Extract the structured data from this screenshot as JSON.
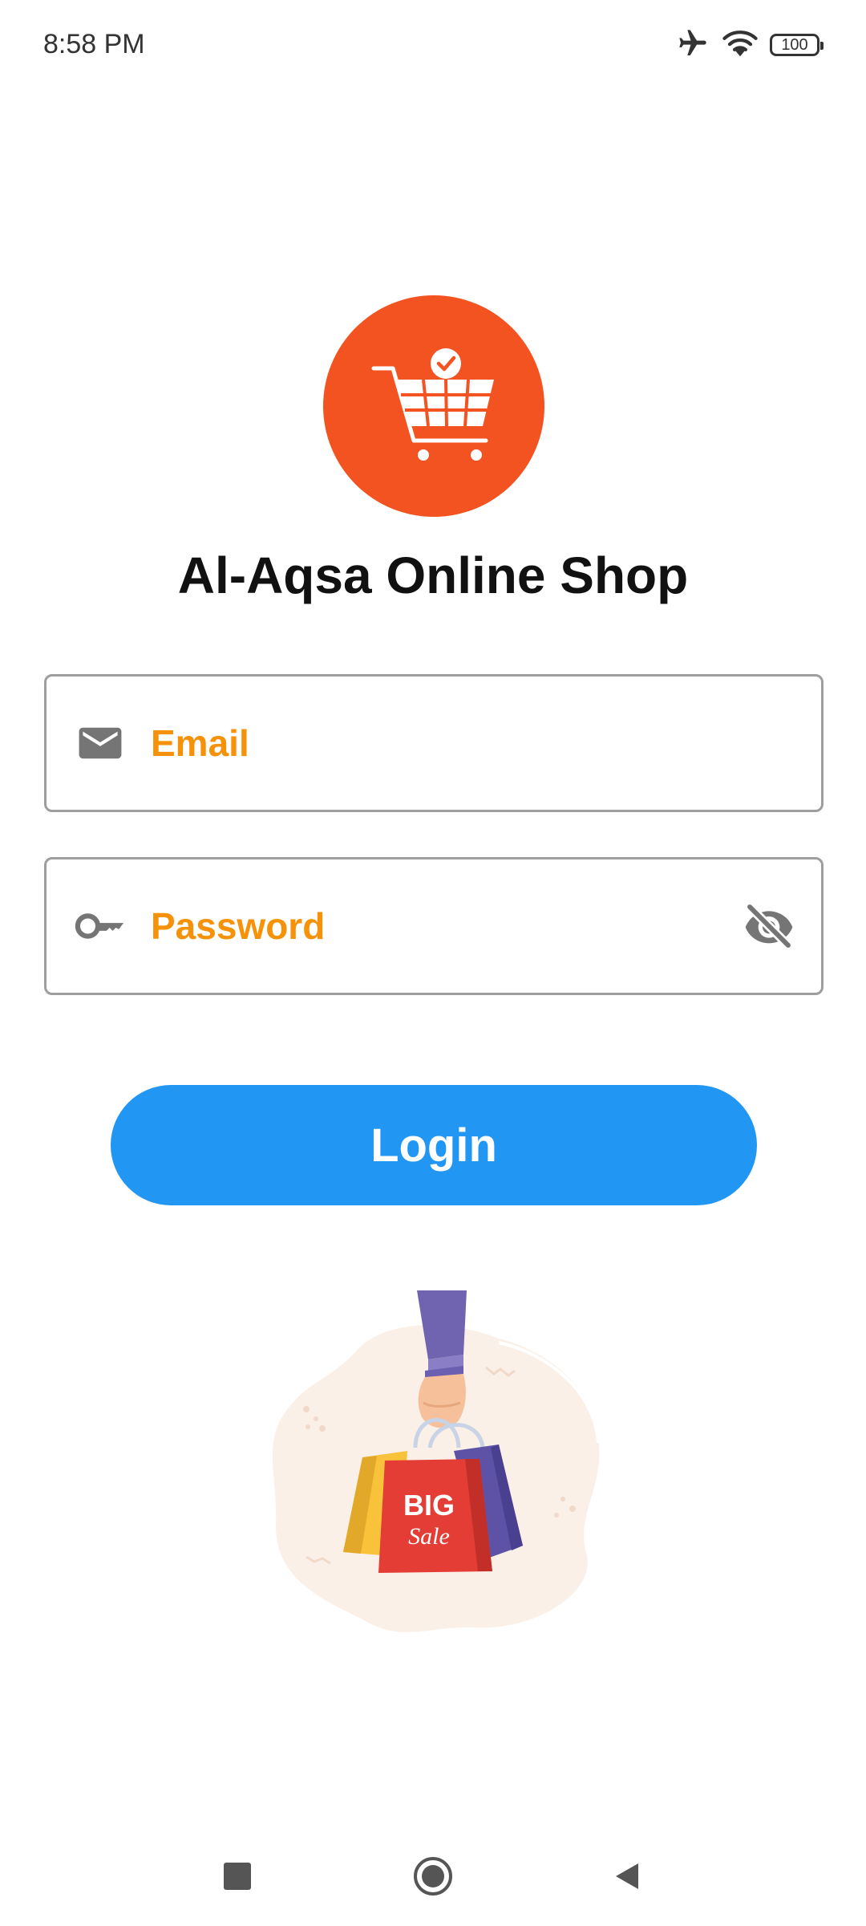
{
  "status_bar": {
    "time": "8:58 PM",
    "battery_level": "100",
    "icons": [
      "airplane-mode-icon",
      "wifi-icon",
      "battery-icon"
    ]
  },
  "app": {
    "title": "Al-Aqsa Online Shop",
    "logo_icon": "shopping-cart-check-icon",
    "brand_color": "#f35321"
  },
  "form": {
    "email": {
      "placeholder": "Email",
      "value": "",
      "icon": "mail-icon"
    },
    "password": {
      "placeholder": "Password",
      "value": "",
      "icon": "key-icon",
      "toggle_icon": "eye-off-icon"
    },
    "login_label": "Login",
    "accent_color": "#f5920a",
    "button_color": "#2196f3"
  },
  "illustration": {
    "bag_text_line1": "BIG",
    "bag_text_line2": "Sale"
  },
  "nav_bar": {
    "items": [
      "recent-apps",
      "home",
      "back"
    ]
  }
}
